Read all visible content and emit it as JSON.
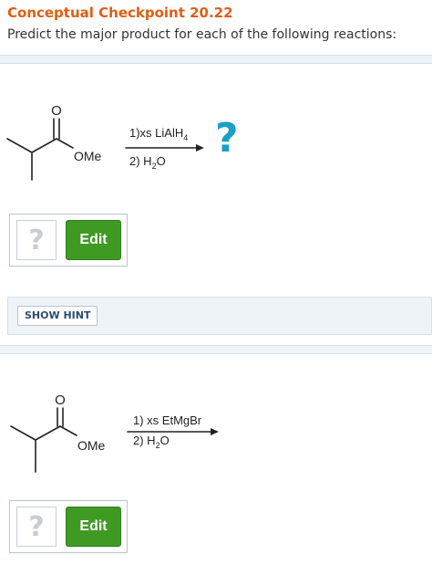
{
  "header": {
    "title": "Conceptual Checkpoint 20.22",
    "subtitle": "Predict the major product for each of the following reactions:"
  },
  "reactions": [
    {
      "atom_o": "O",
      "group": "OMe",
      "step1": "1)xs LiAlH",
      "step1_sub": "4",
      "step2": "2) H",
      "step2_sub": "2",
      "step2_end": "O",
      "product_placeholder": "?",
      "answer_placeholder": "?",
      "edit_label": "Edit"
    },
    {
      "atom_o": "O",
      "group": "OMe",
      "step1": "1) xs EtMgBr",
      "step2": "2) H",
      "step2_sub": "2",
      "step2_end": "O",
      "answer_placeholder": "?",
      "edit_label": "Edit"
    }
  ],
  "hint": {
    "button_label": "SHOW HINT"
  },
  "colors": {
    "title": "#e25d12",
    "accent_question": "#1ba0c6",
    "edit_button": "#3f9a24",
    "panel_bg": "#eef3f8"
  }
}
